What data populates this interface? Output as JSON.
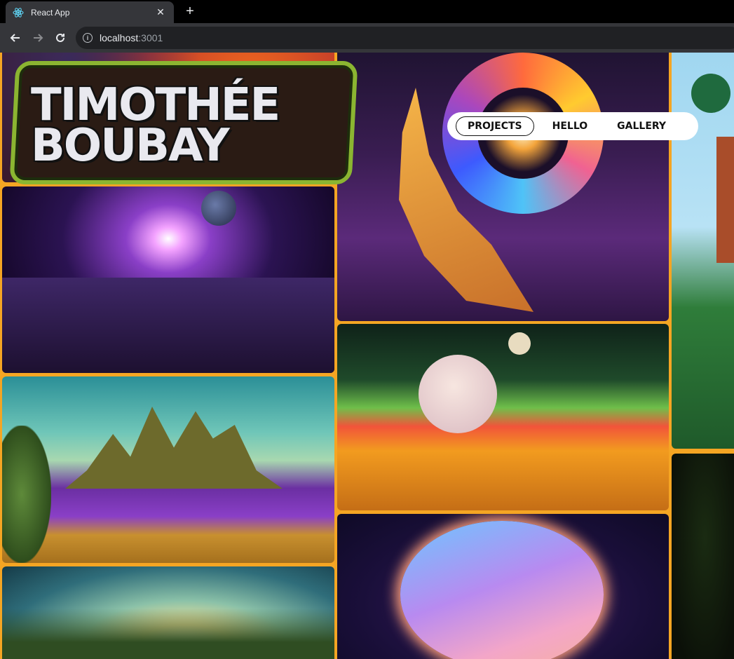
{
  "browser": {
    "tab_title": "React App",
    "url_host": "localhost",
    "url_port": ":3001"
  },
  "site": {
    "logo_line1": "TIMOTHÉE",
    "logo_line2": "BOUBAY",
    "nav": [
      {
        "label": "PROJECTS",
        "active": true
      },
      {
        "label": "HELLO",
        "active": false
      },
      {
        "label": "GALLERY",
        "active": false
      }
    ]
  },
  "colors": {
    "background": "#f5a523",
    "chrome_dark": "#35363a",
    "logo_green": "#8bb531"
  }
}
